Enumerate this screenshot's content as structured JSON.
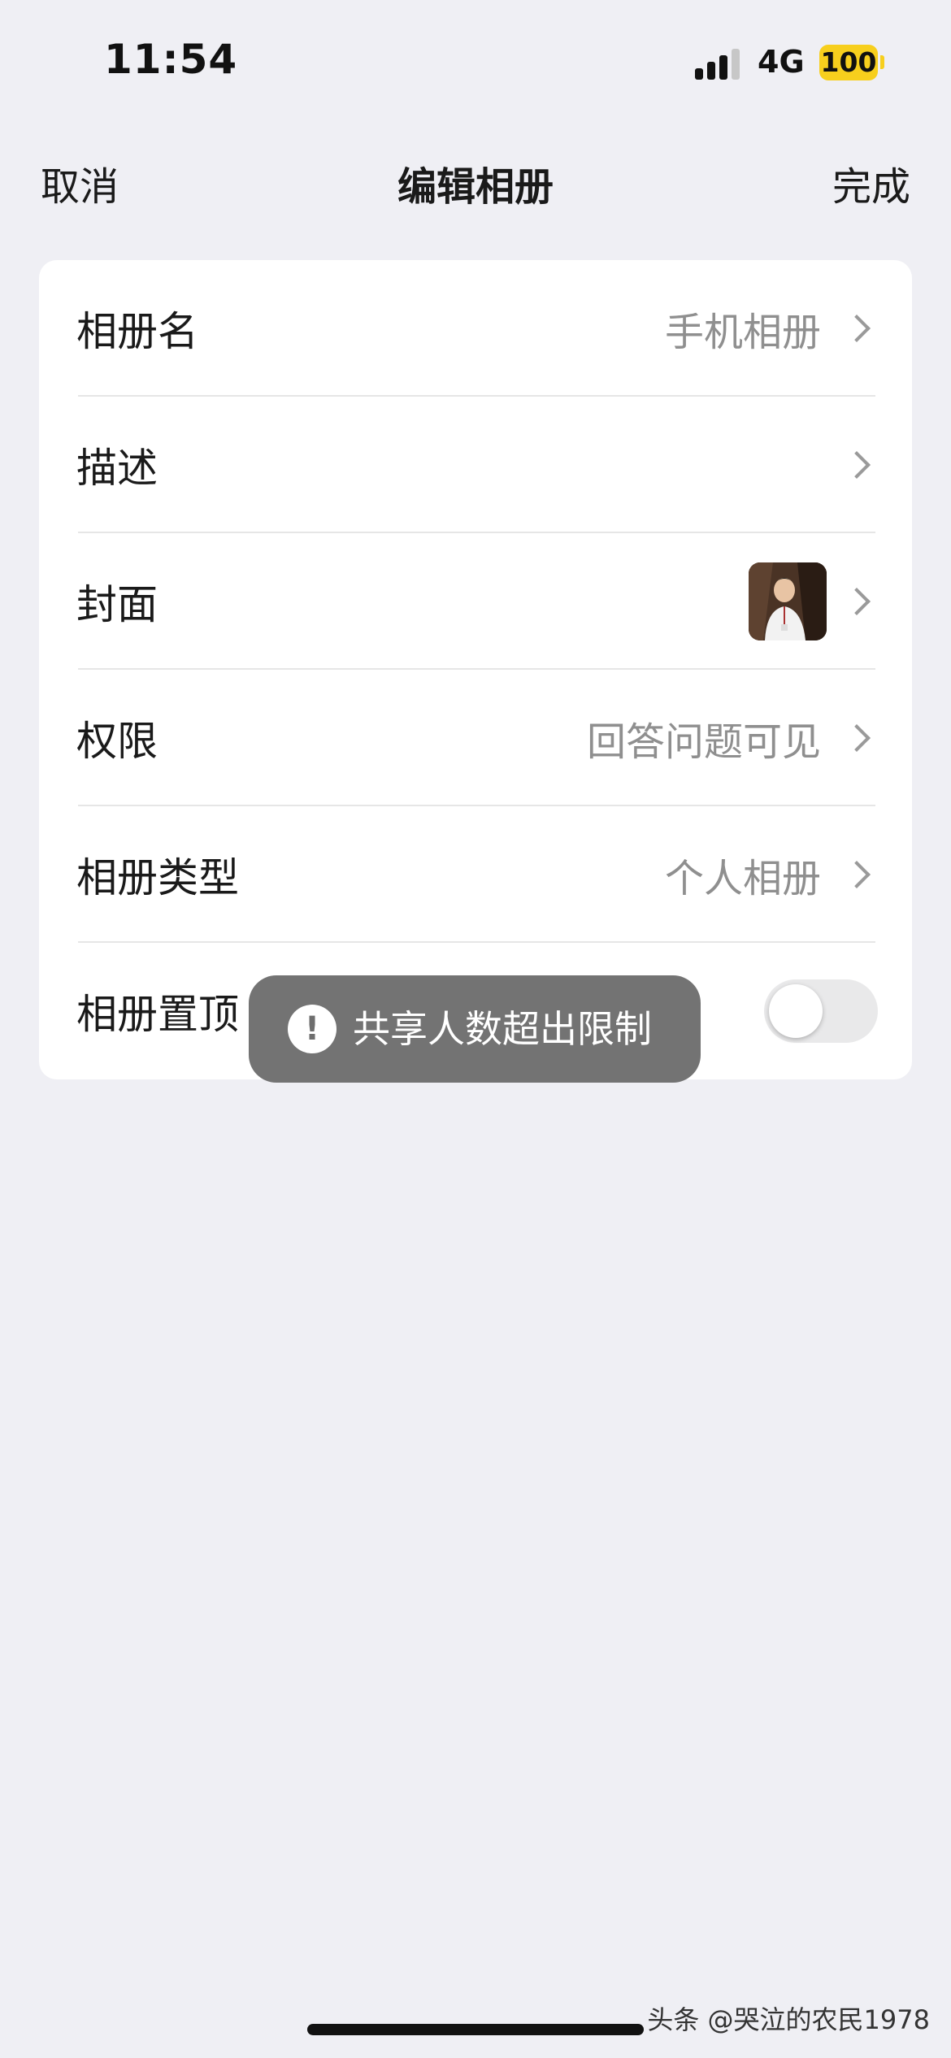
{
  "status_bar": {
    "time": "11:54",
    "network": "4G",
    "battery": "100",
    "battery_color": "#f7cf1d"
  },
  "nav": {
    "cancel_label": "取消",
    "title": "编辑相册",
    "done_label": "完成"
  },
  "rows": [
    {
      "label": "相册名",
      "value": "手机相册"
    },
    {
      "label": "描述",
      "value": ""
    },
    {
      "label": "封面",
      "value": ""
    },
    {
      "label": "权限",
      "value": "回答问题可见"
    },
    {
      "label": "相册类型",
      "value": "个人相册"
    },
    {
      "label": "相册置顶",
      "value": ""
    }
  ],
  "pin_toggle": {
    "on": false
  },
  "toast": {
    "icon": "!",
    "text": "共享人数超出限制"
  },
  "watermark": "头条 @哭泣的农民1978"
}
